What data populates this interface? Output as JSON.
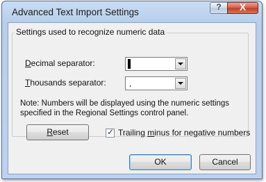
{
  "window": {
    "title": "Advanced Text Import Settings",
    "help_glyph": "?",
    "close_glyph": "X"
  },
  "group": {
    "label": "Settings used to recognize numeric data"
  },
  "decimal": {
    "label_mnemonic": "D",
    "label_rest": "ecimal separator:",
    "value": "."
  },
  "thousands": {
    "label_mnemonic": "T",
    "label_rest": "housands separator:",
    "value": ","
  },
  "note": "Note: Numbers will be displayed using the numeric settings specified in the Regional Settings control panel.",
  "reset": {
    "mnemonic": "R",
    "rest": "eset"
  },
  "trailing_minus": {
    "before": "Trailing ",
    "mnemonic": "m",
    "after": "inus for negative numbers",
    "checked": true
  },
  "buttons": {
    "ok": "OK",
    "cancel": "Cancel"
  }
}
